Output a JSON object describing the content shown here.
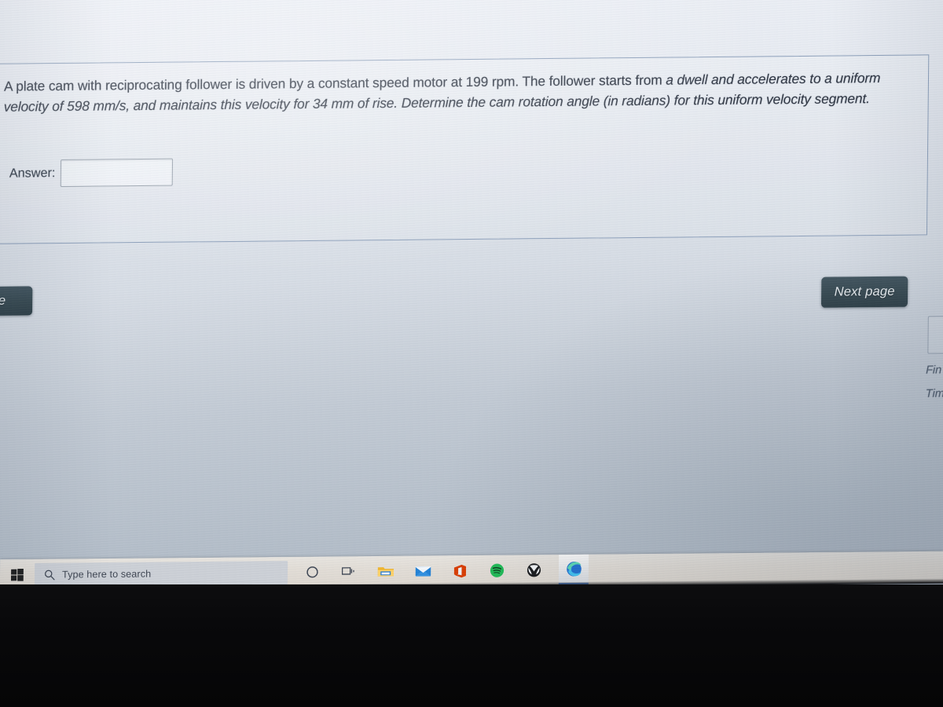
{
  "quiz": {
    "question_text_parts": [
      {
        "text": "A plate cam with reciprocating follower is driven by a constant speed motor at 199 rpm. The follower starts from ",
        "italic": false
      },
      {
        "text": "a dwell and accelerates to a uniform velocity of 598 mm/s, and maintains this velocity for 34 mm of rise. Determine the cam rotation angle (in radians) for this uniform velocity segment.",
        "italic": true
      }
    ],
    "question_text_plain": "A plate cam with reciprocating follower is driven by a constant speed motor at 199 rpm. The follower starts from a dwell and accelerates to a uniform velocity of 598 mm/s, and maintains this velocity for 34 mm of rise. Determine the cam rotation angle (in radians) for this uniform velocity segment.",
    "answer_label": "Answer:",
    "answer_value": "",
    "answer_placeholder": ""
  },
  "navigation": {
    "previous_page_label": "Previous page",
    "previous_page_visible_text": "age",
    "next_page_label": "Next page",
    "finish_attempt_label": "Finish attempt ...",
    "finish_attempt_visible_text": "Fin",
    "time_left_label": "Time left",
    "time_left_visible_text": "Tim"
  },
  "taskbar": {
    "start_icon": "windows-logo-icon",
    "search_placeholder": "Type here to search",
    "search_icon": "search-icon",
    "icons": [
      {
        "name": "cortana-icon",
        "label": "Cortana"
      },
      {
        "name": "task-view-icon",
        "label": "Task View"
      },
      {
        "name": "file-explorer-icon",
        "label": "File Explorer"
      },
      {
        "name": "mail-icon",
        "label": "Mail"
      },
      {
        "name": "office-icon",
        "label": "Office"
      },
      {
        "name": "spotify-icon",
        "label": "Spotify"
      },
      {
        "name": "xbox-icon",
        "label": "Xbox"
      },
      {
        "name": "edge-icon",
        "label": "Microsoft Edge"
      }
    ]
  },
  "colors": {
    "page_background_top": "#eef1f7",
    "page_background_bottom": "#aeb8c4",
    "question_border": "#8c9fba",
    "button_background": "#35474f",
    "button_text": "#e9eef1",
    "text_primary": "#2c3340",
    "link_text": "#4d5a6b",
    "taskbar_background": "#e2ddd6",
    "search_box_background": "#ccd0d6",
    "edge_active_indicator": "#2d6fd4",
    "offscreen_black": "#09090b"
  }
}
